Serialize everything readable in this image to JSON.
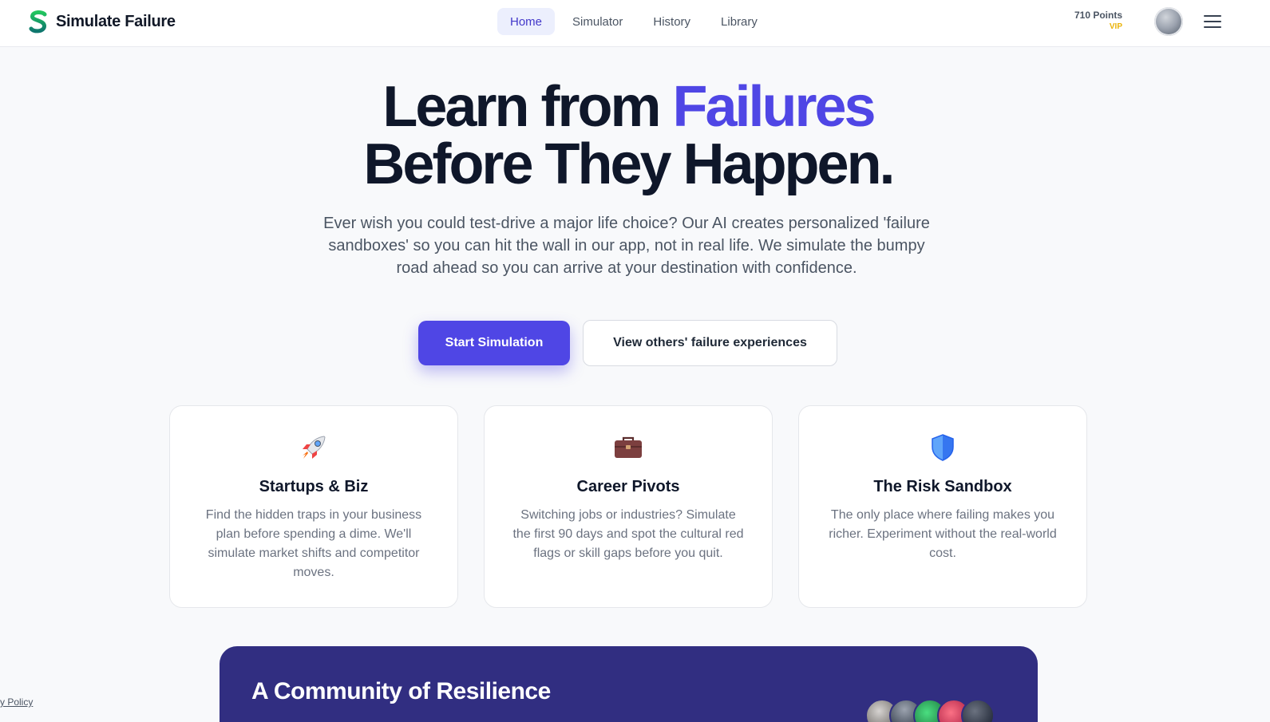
{
  "header": {
    "brand_name": "Simulate Failure",
    "nav": [
      {
        "label": "Home",
        "active": true
      },
      {
        "label": "Simulator",
        "active": false
      },
      {
        "label": "History",
        "active": false
      },
      {
        "label": "Library",
        "active": false
      }
    ],
    "points": "710 Points",
    "badge": "VIP"
  },
  "hero": {
    "title_line1_plain": "Learn from",
    "title_line1_accent": "Failures",
    "title_line2": "Before They Happen.",
    "subtitle": "Ever wish you could test-drive a major life choice? Our AI creates personalized 'failure sandboxes' so you can hit the wall in our app, not in real life. We simulate the bumpy road ahead so you can arrive at your destination with confidence.",
    "primary_cta": "Start Simulation",
    "secondary_cta": "View others' failure experiences"
  },
  "cards": [
    {
      "icon": "rocket-icon",
      "title": "Startups & Biz",
      "desc": "Find the hidden traps in your business plan before spending a dime. We'll simulate market shifts and competitor moves."
    },
    {
      "icon": "briefcase-icon",
      "title": "Career Pivots",
      "desc": "Switching jobs or industries? Simulate the first 90 days and spot the cultural red flags or skill gaps before you quit."
    },
    {
      "icon": "shield-icon",
      "title": "The Risk Sandbox",
      "desc": "The only place where failing makes you richer. Experiment without the real-world cost."
    }
  ],
  "community": {
    "title": "A Community of Resilience"
  },
  "footer": {
    "policy_link": "y Policy"
  },
  "colors": {
    "accent": "#4f46e5",
    "community_bg": "#312e81",
    "vip": "#eab308"
  }
}
